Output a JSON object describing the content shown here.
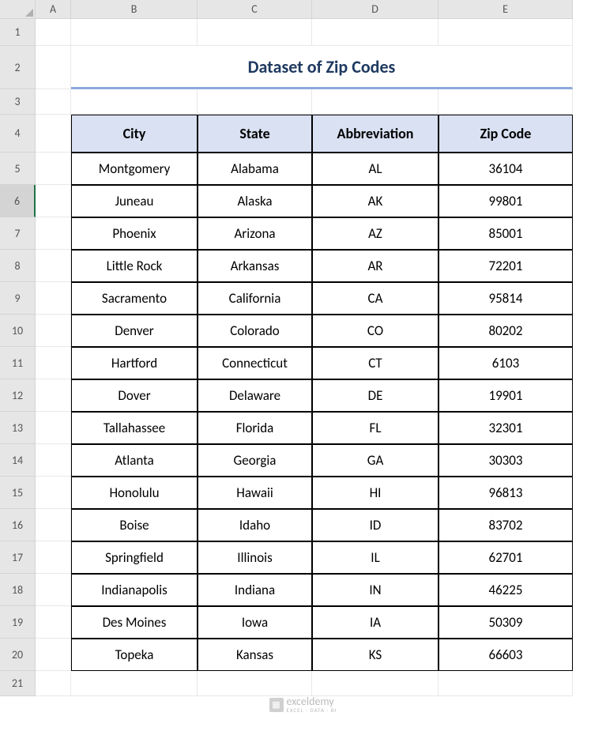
{
  "columns": [
    "A",
    "B",
    "C",
    "D",
    "E"
  ],
  "rows": [
    "1",
    "2",
    "3",
    "4",
    "5",
    "6",
    "7",
    "8",
    "9",
    "10",
    "11",
    "12",
    "13",
    "14",
    "15",
    "16",
    "17",
    "18",
    "19",
    "20",
    "21"
  ],
  "selected_row": "6",
  "title": "Dataset of Zip Codes",
  "headers": {
    "city": "City",
    "state": "State",
    "abbreviation": "Abbreviation",
    "zip": "Zip Code"
  },
  "data": [
    {
      "city": "Montgomery",
      "state": "Alabama",
      "abbr": "AL",
      "zip": "36104"
    },
    {
      "city": "Juneau",
      "state": "Alaska",
      "abbr": "AK",
      "zip": "99801"
    },
    {
      "city": "Phoenix",
      "state": "Arizona",
      "abbr": "AZ",
      "zip": "85001"
    },
    {
      "city": "Little Rock",
      "state": "Arkansas",
      "abbr": "AR",
      "zip": "72201"
    },
    {
      "city": "Sacramento",
      "state": "California",
      "abbr": "CA",
      "zip": "95814"
    },
    {
      "city": "Denver",
      "state": "Colorado",
      "abbr": "CO",
      "zip": "80202"
    },
    {
      "city": "Hartford",
      "state": "Connecticut",
      "abbr": "CT",
      "zip": "6103"
    },
    {
      "city": "Dover",
      "state": "Delaware",
      "abbr": "DE",
      "zip": "19901"
    },
    {
      "city": "Tallahassee",
      "state": "Florida",
      "abbr": "FL",
      "zip": "32301"
    },
    {
      "city": "Atlanta",
      "state": "Georgia",
      "abbr": "GA",
      "zip": "30303"
    },
    {
      "city": "Honolulu",
      "state": "Hawaii",
      "abbr": "HI",
      "zip": "96813"
    },
    {
      "city": "Boise",
      "state": "Idaho",
      "abbr": "ID",
      "zip": "83702"
    },
    {
      "city": "Springfield",
      "state": "Illinois",
      "abbr": "IL",
      "zip": "62701"
    },
    {
      "city": "Indianapolis",
      "state": "Indiana",
      "abbr": "IN",
      "zip": "46225"
    },
    {
      "city": "Des Moines",
      "state": "Iowa",
      "abbr": "IA",
      "zip": "50309"
    },
    {
      "city": "Topeka",
      "state": "Kansas",
      "abbr": "KS",
      "zip": "66603"
    }
  ],
  "watermark": {
    "name": "exceldemy",
    "sub": "EXCEL · DATA · BI"
  }
}
